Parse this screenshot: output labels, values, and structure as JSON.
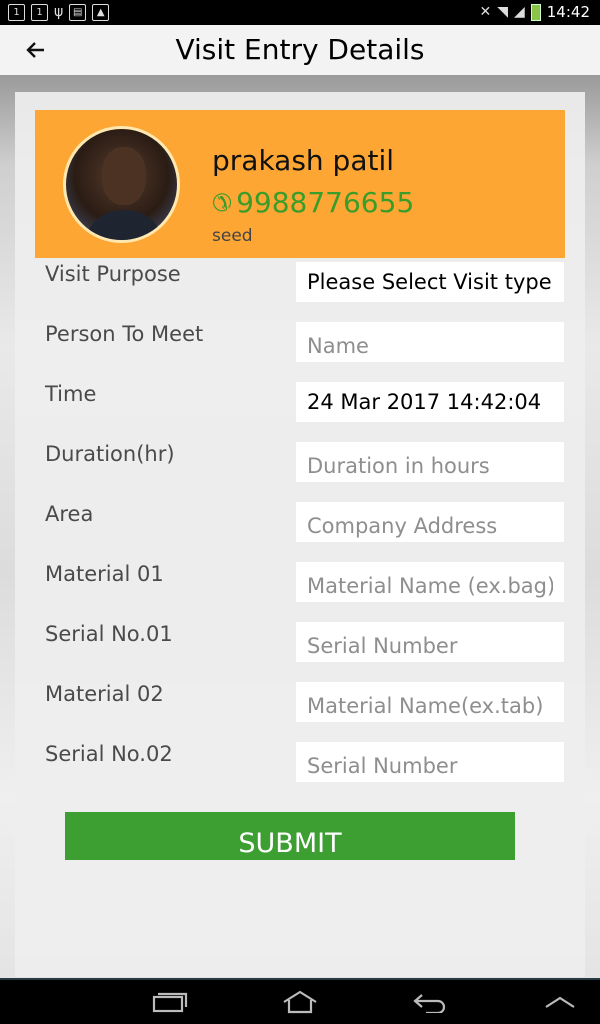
{
  "status_bar": {
    "time": "14:42",
    "left_icons": [
      "screen-icon",
      "screen-icon",
      "usb-icon",
      "sim-icon",
      "image-icon"
    ],
    "battery_color": "#8bc34a"
  },
  "app_bar": {
    "title": "Visit Entry Details",
    "back_icon": "arrow-left-icon"
  },
  "profile": {
    "name": "prakash patil",
    "phone": "9988776655",
    "sub": "seed",
    "background_color": "#fda634",
    "phone_color": "#3a9d2a"
  },
  "form": {
    "fields": [
      {
        "label": "Visit Purpose",
        "placeholder": "",
        "value": "Please Select Visit type"
      },
      {
        "label": "Person To Meet",
        "placeholder": "Name",
        "value": ""
      },
      {
        "label": "Time",
        "placeholder": "",
        "value": "24 Mar 2017 14:42:04"
      },
      {
        "label": "Duration(hr)",
        "placeholder": "Duration in hours",
        "value": ""
      },
      {
        "label": "Area",
        "placeholder": "Company Address",
        "value": ""
      },
      {
        "label": "Material 01",
        "placeholder": "Material Name (ex.bag)",
        "value": ""
      },
      {
        "label": "Serial No.01",
        "placeholder": "Serial Number",
        "value": ""
      },
      {
        "label": "Material 02",
        "placeholder": "Material Name(ex.tab)",
        "value": ""
      },
      {
        "label": "Serial No.02",
        "placeholder": "Serial Number",
        "value": ""
      }
    ],
    "submit_label": "SUBMIT",
    "submit_color": "#3d9e31"
  },
  "nav_bar": {
    "icons": [
      "recent-apps-icon",
      "home-icon",
      "back-icon",
      "chevron-up-icon"
    ]
  }
}
